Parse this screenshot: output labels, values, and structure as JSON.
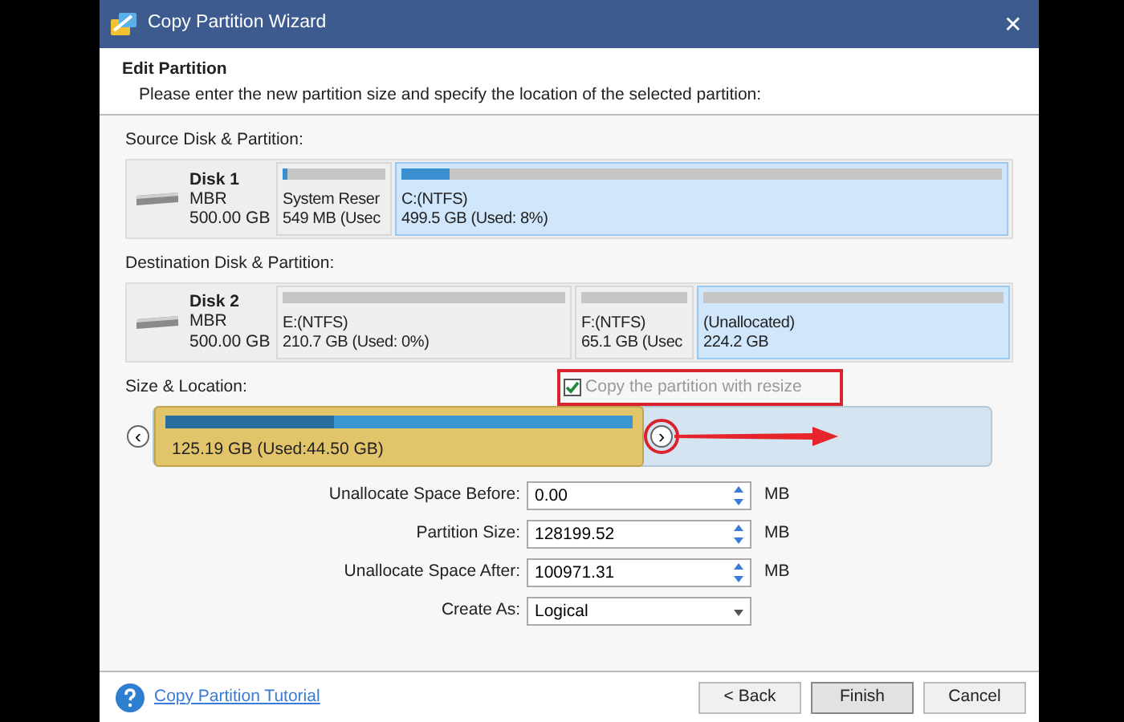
{
  "window": {
    "title": "Copy Partition Wizard",
    "close": "✕"
  },
  "header": {
    "title": "Edit Partition",
    "subtitle": "Please enter the new partition size and specify the location of the selected partition:"
  },
  "source": {
    "label": "Source Disk & Partition:",
    "disk": {
      "name": "Disk 1",
      "type": "MBR",
      "size": "500.00 GB"
    },
    "partitions": [
      {
        "name": "System Reser",
        "size": "549 MB (Usec",
        "level": 0.05,
        "selected": false
      },
      {
        "name": "C:(NTFS)",
        "size": "499.5 GB (Used: 8%)",
        "level": 0.08,
        "selected": true
      }
    ]
  },
  "destination": {
    "label": "Destination Disk & Partition:",
    "disk": {
      "name": "Disk 2",
      "type": "MBR",
      "size": "500.00 GB"
    },
    "partitions": [
      {
        "name": "E:(NTFS)",
        "size": "210.7 GB (Used: 0%)",
        "level": 0,
        "selected": false
      },
      {
        "name": "F:(NTFS)",
        "size": "65.1 GB (Usec",
        "level": 0,
        "selected": false
      },
      {
        "name": "(Unallocated)",
        "size": "224.2 GB",
        "level": 0,
        "selected": true
      }
    ]
  },
  "size_location": {
    "label": "Size & Location:",
    "resize": {
      "label": "Copy the partition with resize",
      "checked": true,
      "highlighted": true
    },
    "partition": {
      "text": "125.19 GB (Used:44.50 GB)",
      "level": 0.36
    },
    "left_handle": {
      "symbol": "‹",
      "highlighted": false
    },
    "right_handle": {
      "symbol": "›",
      "highlighted": true
    }
  },
  "fields": [
    {
      "kind": "spin",
      "label": "Unallocate Space Before:",
      "value": "0.00",
      "unit": "MB"
    },
    {
      "kind": "spin",
      "label": "Partition Size:",
      "value": "128199.52",
      "unit": "MB"
    },
    {
      "kind": "spin",
      "label": "Unallocate Space After:",
      "value": "100971.31",
      "unit": "MB"
    },
    {
      "kind": "select",
      "label": "Create As:",
      "value": "Logical"
    }
  ],
  "footer": {
    "tutorial": "Copy Partition Tutorial",
    "buttons": [
      {
        "label": "< Back",
        "default": false
      },
      {
        "label": "Finish",
        "default": true
      },
      {
        "label": "Cancel",
        "default": false
      }
    ]
  }
}
